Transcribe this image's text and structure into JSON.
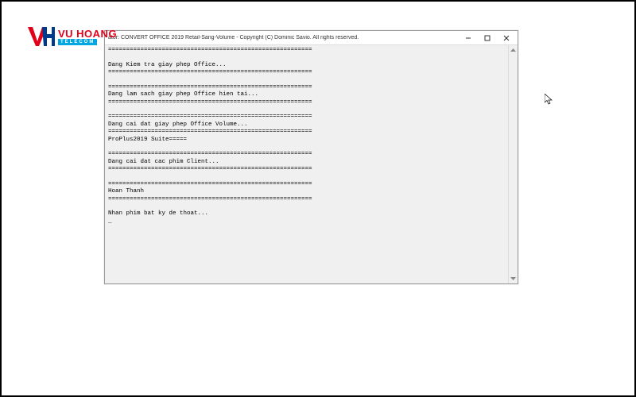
{
  "logo": {
    "brand": "VU HOANG",
    "sub": "TELECOM"
  },
  "window": {
    "title": "ator:  CONVERT OFFICE 2019 Retail-Sang-Volume - Copyright (C) Dominic Savio. All rights reserved."
  },
  "console": {
    "lines": [
      "=========================================================",
      "",
      "Dang Kiem tra giay phep Office...",
      "=========================================================",
      "",
      "=========================================================",
      "Dang lam sach giay phep Office hien tai...",
      "=========================================================",
      "",
      "=========================================================",
      "Dang cai dat giay phep Office Volume...",
      "=========================================================",
      "ProPlus2019 Suite=====",
      "",
      "=========================================================",
      "Dang cai dat cac phim Client...",
      "=========================================================",
      "",
      "=========================================================",
      "Hoan Thanh",
      "=========================================================",
      "",
      "Nhan phim bat ky de thoat...",
      "_"
    ]
  }
}
